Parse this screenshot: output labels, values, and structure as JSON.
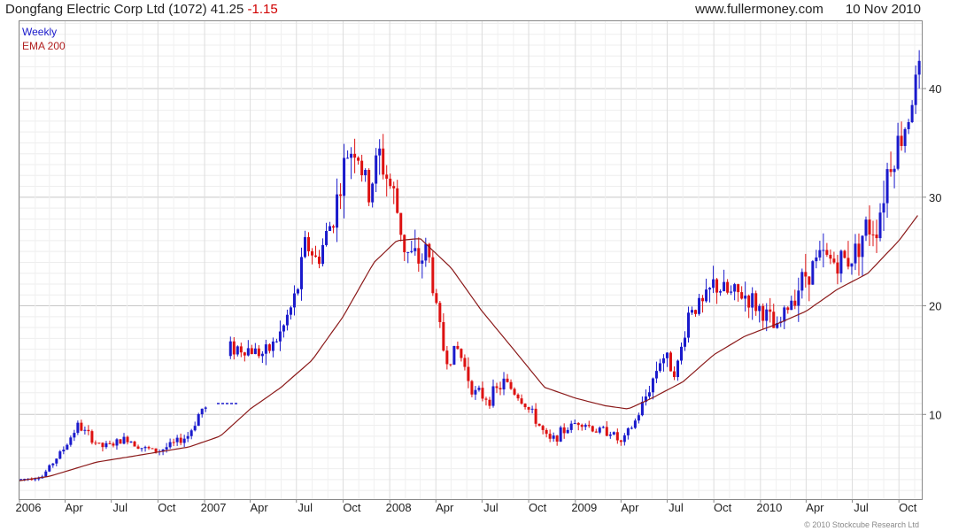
{
  "header": {
    "title": "Dongfang Electric Corp Ltd (1072) 41.25",
    "change": "-1.15",
    "source": "www.fullermoney.com",
    "date": "10 Nov 2010"
  },
  "legend": {
    "series1": "Weekly",
    "series2": "EMA 200"
  },
  "copyright": "© 2010 Stockcube Research Ltd",
  "colors": {
    "up": "#1a1acc",
    "down": "#dd1111",
    "ema": "#8b1a1a",
    "grid": "#dddddd"
  },
  "chart_data": {
    "type": "candlestick",
    "interval": "weekly",
    "x_tick_labels": [
      "2006",
      "Apr",
      "Jul",
      "Oct",
      "2007",
      "Apr",
      "Jul",
      "Oct",
      "2008",
      "Apr",
      "Jul",
      "Oct",
      "2009",
      "Apr",
      "Jul",
      "Oct",
      "2010",
      "Apr",
      "Jul",
      "Oct"
    ],
    "y_ticks": [
      10,
      20,
      30,
      40
    ],
    "ylim": [
      2.2,
      46.2
    ],
    "xlim": [
      "2006-01-01",
      "2010-11-15"
    ],
    "price_anchors": [
      [
        "2006-01-01",
        4.0
      ],
      [
        "2006-02-15",
        4.3
      ],
      [
        "2006-03-15",
        6.0
      ],
      [
        "2006-04-01",
        7.0
      ],
      [
        "2006-04-25",
        9.0
      ],
      [
        "2006-05-10",
        8.4
      ],
      [
        "2006-06-10",
        7.0
      ],
      [
        "2006-07-01",
        7.2
      ],
      [
        "2006-08-01",
        7.8
      ],
      [
        "2006-09-01",
        6.9
      ],
      [
        "2006-10-01",
        6.6
      ],
      [
        "2006-11-01",
        7.3
      ],
      [
        "2006-12-01",
        8.1
      ],
      [
        "2006-12-25",
        10.5
      ],
      [
        "2007-02-10",
        10.6
      ],
      [
        "2007-02-20",
        16.2
      ],
      [
        "2007-04-01",
        16.0
      ],
      [
        "2007-05-01",
        15.5
      ],
      [
        "2007-06-01",
        17.5
      ],
      [
        "2007-07-01",
        21.0
      ],
      [
        "2007-07-20",
        26.0
      ],
      [
        "2007-08-10",
        24.0
      ],
      [
        "2007-09-10",
        28.0
      ],
      [
        "2007-10-10",
        34.0
      ],
      [
        "2007-10-25",
        35.0
      ],
      [
        "2007-11-20",
        30.0
      ],
      [
        "2007-12-10",
        34.0
      ],
      [
        "2008-01-10",
        30.0
      ],
      [
        "2008-02-01",
        25.0
      ],
      [
        "2008-03-01",
        24.0
      ],
      [
        "2008-03-15",
        25.5
      ],
      [
        "2008-04-01",
        20.0
      ],
      [
        "2008-04-20",
        15.0
      ],
      [
        "2008-05-15",
        16.0
      ],
      [
        "2008-06-15",
        12.0
      ],
      [
        "2008-07-15",
        11.5
      ],
      [
        "2008-08-15",
        13.0
      ],
      [
        "2008-09-15",
        11.5
      ],
      [
        "2008-10-15",
        9.5
      ],
      [
        "2008-11-10",
        7.5
      ],
      [
        "2008-12-10",
        8.5
      ],
      [
        "2009-01-10",
        9.5
      ],
      [
        "2009-02-10",
        8.5
      ],
      [
        "2009-03-10",
        8.5
      ],
      [
        "2009-04-01",
        7.3
      ],
      [
        "2009-05-01",
        9.5
      ],
      [
        "2009-06-01",
        13.0
      ],
      [
        "2009-06-20",
        15.5
      ],
      [
        "2009-07-20",
        14.0
      ],
      [
        "2009-08-15",
        20.0
      ],
      [
        "2009-09-10",
        20.0
      ],
      [
        "2009-10-01",
        22.0
      ],
      [
        "2009-11-01",
        21.0
      ],
      [
        "2009-12-01",
        21.0
      ],
      [
        "2010-01-15",
        19.0
      ],
      [
        "2010-02-01",
        17.5
      ],
      [
        "2010-03-01",
        20.5
      ],
      [
        "2010-04-01",
        23.0
      ],
      [
        "2010-05-01",
        24.5
      ],
      [
        "2010-06-01",
        24.0
      ],
      [
        "2010-07-01",
        24.5
      ],
      [
        "2010-07-25",
        27.0
      ],
      [
        "2010-08-20",
        27.5
      ],
      [
        "2010-09-10",
        33.0
      ],
      [
        "2010-10-10",
        36.0
      ],
      [
        "2010-10-25",
        39.0
      ],
      [
        "2010-11-10",
        41.25
      ]
    ],
    "ema200_anchors": [
      [
        "2006-01-01",
        3.9
      ],
      [
        "2006-03-01",
        4.3
      ],
      [
        "2006-06-01",
        5.6
      ],
      [
        "2006-09-01",
        6.3
      ],
      [
        "2006-12-01",
        7.0
      ],
      [
        "2007-02-01",
        8.0
      ],
      [
        "2007-04-01",
        10.5
      ],
      [
        "2007-06-01",
        12.5
      ],
      [
        "2007-08-01",
        15.0
      ],
      [
        "2007-10-01",
        19.0
      ],
      [
        "2007-12-01",
        24.0
      ],
      [
        "2008-01-15",
        26.0
      ],
      [
        "2008-03-01",
        26.2
      ],
      [
        "2008-05-01",
        23.5
      ],
      [
        "2008-07-01",
        19.5
      ],
      [
        "2008-09-01",
        16.0
      ],
      [
        "2008-11-01",
        12.5
      ],
      [
        "2009-01-01",
        11.5
      ],
      [
        "2009-03-01",
        10.8
      ],
      [
        "2009-04-15",
        10.5
      ],
      [
        "2009-06-01",
        11.5
      ],
      [
        "2009-08-01",
        13.0
      ],
      [
        "2009-10-01",
        15.5
      ],
      [
        "2009-12-01",
        17.2
      ],
      [
        "2010-02-01",
        18.3
      ],
      [
        "2010-04-01",
        19.5
      ],
      [
        "2010-06-01",
        21.5
      ],
      [
        "2010-08-01",
        23.0
      ],
      [
        "2010-10-01",
        26.0
      ],
      [
        "2010-11-10",
        28.5
      ]
    ]
  }
}
